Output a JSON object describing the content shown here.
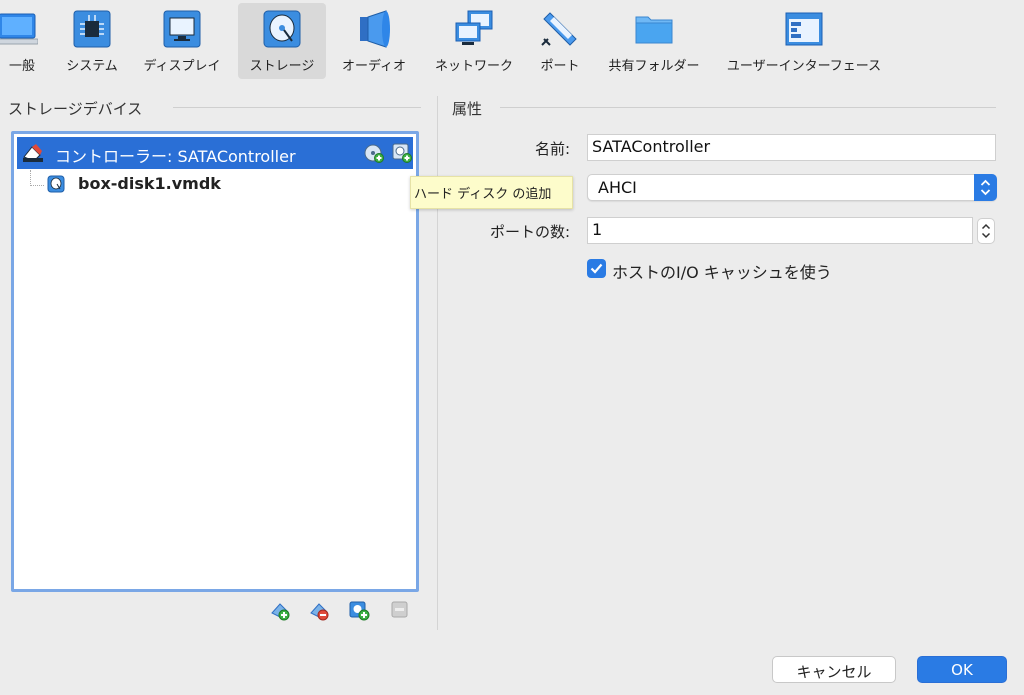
{
  "toolbar": {
    "items": [
      {
        "label": "一般",
        "icon": "general-icon"
      },
      {
        "label": "システム",
        "icon": "system-chip-icon"
      },
      {
        "label": "ディスプレイ",
        "icon": "display-monitor-icon"
      },
      {
        "label": "ストレージ",
        "icon": "storage-disk-icon"
      },
      {
        "label": "オーディオ",
        "icon": "audio-speaker-icon"
      },
      {
        "label": "ネットワーク",
        "icon": "network-icon"
      },
      {
        "label": "ポート",
        "icon": "port-connector-icon"
      },
      {
        "label": "共有フォルダー",
        "icon": "shared-folder-icon"
      },
      {
        "label": "ユーザーインターフェース",
        "icon": "user-interface-window-icon"
      }
    ],
    "selected": "ストレージ"
  },
  "left": {
    "section_title": "ストレージデバイス",
    "controller_label": "コントローラー: SATAController",
    "disk_label": "box-disk1.vmdk"
  },
  "tooltip": {
    "text": "ハード ディスク の追加"
  },
  "right": {
    "section_title": "属性",
    "name_label": "名前:",
    "name_value": "SATAController",
    "type_value": "AHCI",
    "ports_label": "ポートの数:",
    "ports_value": "1",
    "cache_label": "ホストのI/O キャッシュを使う",
    "cache_checked": true
  },
  "buttons": {
    "cancel": "キャンセル",
    "ok": "OK"
  },
  "colors": {
    "accent": "#2a7be4",
    "selection": "#2a6fd6",
    "tooltip_bg": "#fdfccb"
  }
}
